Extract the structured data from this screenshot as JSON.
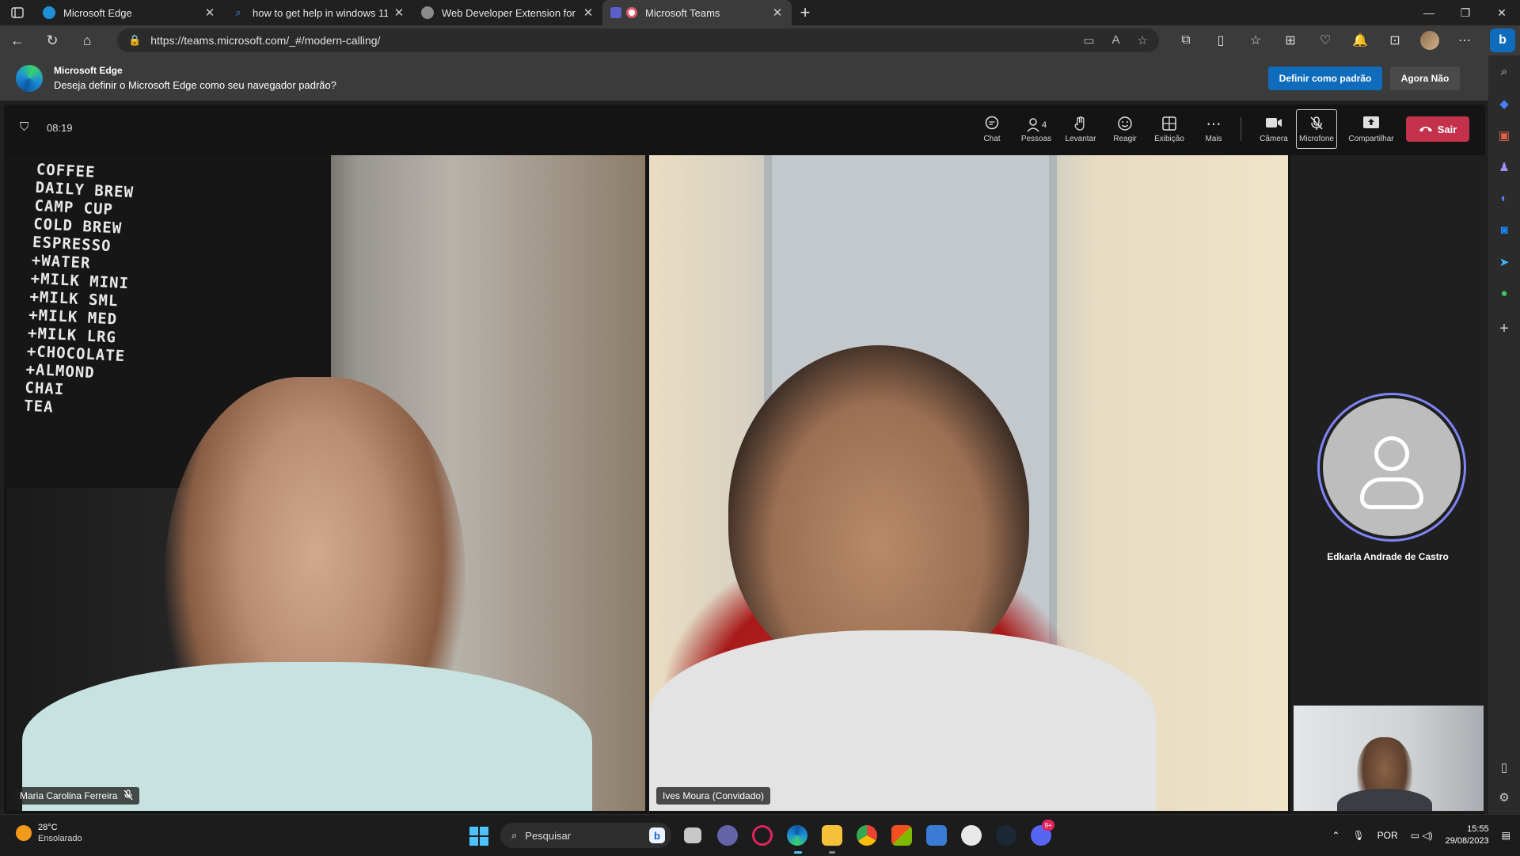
{
  "browser": {
    "tabs": [
      {
        "title": "Microsoft Edge",
        "active": false,
        "fav_color": "#1e90d6"
      },
      {
        "title": "how to get help in windows 11 -",
        "active": false,
        "fav_color": "#2f6fd6"
      },
      {
        "title": "Web Developer Extension for Ch",
        "active": false,
        "fav_color": "#8a8a8a"
      },
      {
        "title": "Microsoft Teams",
        "active": true,
        "fav_color": "#e05a6a"
      }
    ],
    "url": "https://teams.microsoft.com/_#/modern-calling/",
    "infobar": {
      "title": "Microsoft Edge",
      "message": "Deseja definir o Microsoft Edge como seu navegador padrão?",
      "primary_button": "Definir como padrão",
      "secondary_button": "Agora Não"
    }
  },
  "teams": {
    "timer": "08:19",
    "controls": [
      {
        "icon": "chat-icon",
        "label": "Chat",
        "glyph": "💬"
      },
      {
        "icon": "people-icon",
        "label": "Pessoas",
        "glyph": "👤",
        "count": "4"
      },
      {
        "icon": "raise-hand-icon",
        "label": "Levantar",
        "glyph": "✋"
      },
      {
        "icon": "react-icon",
        "label": "Reagir",
        "glyph": "☺"
      },
      {
        "icon": "view-icon",
        "label": "Exibição",
        "glyph": "⊞"
      },
      {
        "icon": "more-icon",
        "label": "Mais",
        "glyph": "⋯"
      },
      {
        "icon": "camera-icon",
        "label": "Câmera",
        "glyph": "■"
      },
      {
        "icon": "mic-off-icon",
        "label": "Microfone",
        "glyph": "🎙"
      },
      {
        "icon": "share-icon",
        "label": "Compartilhar",
        "glyph": "⬆"
      }
    ],
    "leave_label": "Sair",
    "participants": [
      {
        "name": "Maria Carolina Ferreira",
        "muted": true
      },
      {
        "name": "Ives Moura (Convidado)",
        "muted": false
      },
      {
        "name": "Edkarla Andrade de Castro",
        "muted": false
      }
    ],
    "menu_board_text": [
      "COFFEE",
      "DAILY BREW",
      "CAMP CUP",
      "COLD BREW",
      "ESPRESSO",
      "+WATER",
      "+MILK  MINI",
      "+MILK  SML",
      "+MILK  MED",
      "+MILK  LRG",
      "+CHOCOLATE",
      "+ALMOND",
      "CHAI",
      "TEA"
    ],
    "accent_color": "#7f85f5",
    "leave_color": "#c4314b"
  },
  "taskbar": {
    "weather_temp": "28°C",
    "weather_desc": "Ensolarado",
    "search_placeholder": "Pesquisar",
    "language": "POR",
    "time": "15:55",
    "date": "29/08/2023",
    "discord_badge": "9+"
  }
}
